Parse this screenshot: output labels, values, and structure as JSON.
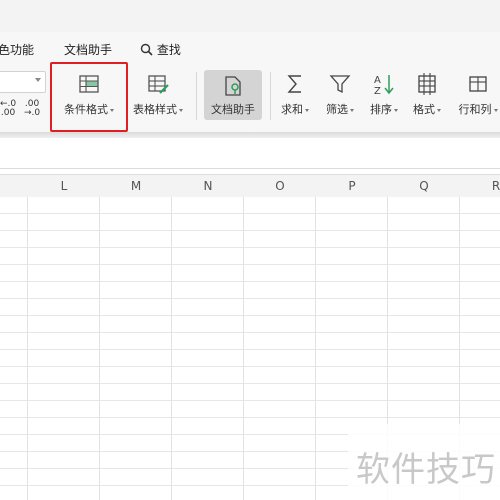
{
  "menu": {
    "feature_partial": "色功能",
    "doc_assistant": "文档助手",
    "search": "查找"
  },
  "number_format": {
    "increase_decimal": [
      ".00",
      "←.0"
    ],
    "decrease_decimal": [
      ".00",
      "→.0"
    ]
  },
  "toolbar": {
    "conditional_format": "条件格式",
    "table_style": "表格样式",
    "doc_assistant": "文档助手",
    "sum": "求和",
    "filter": "筛选",
    "sort": "排序",
    "format": "格式",
    "row_col": "行和列"
  },
  "columns": [
    "L",
    "M",
    "N",
    "O",
    "P",
    "Q",
    "R"
  ],
  "watermark": "软件技巧",
  "colors": {
    "highlight": "#e02020",
    "active_tool": "#d4d4d4",
    "accent_green": "#2e9e5b"
  }
}
